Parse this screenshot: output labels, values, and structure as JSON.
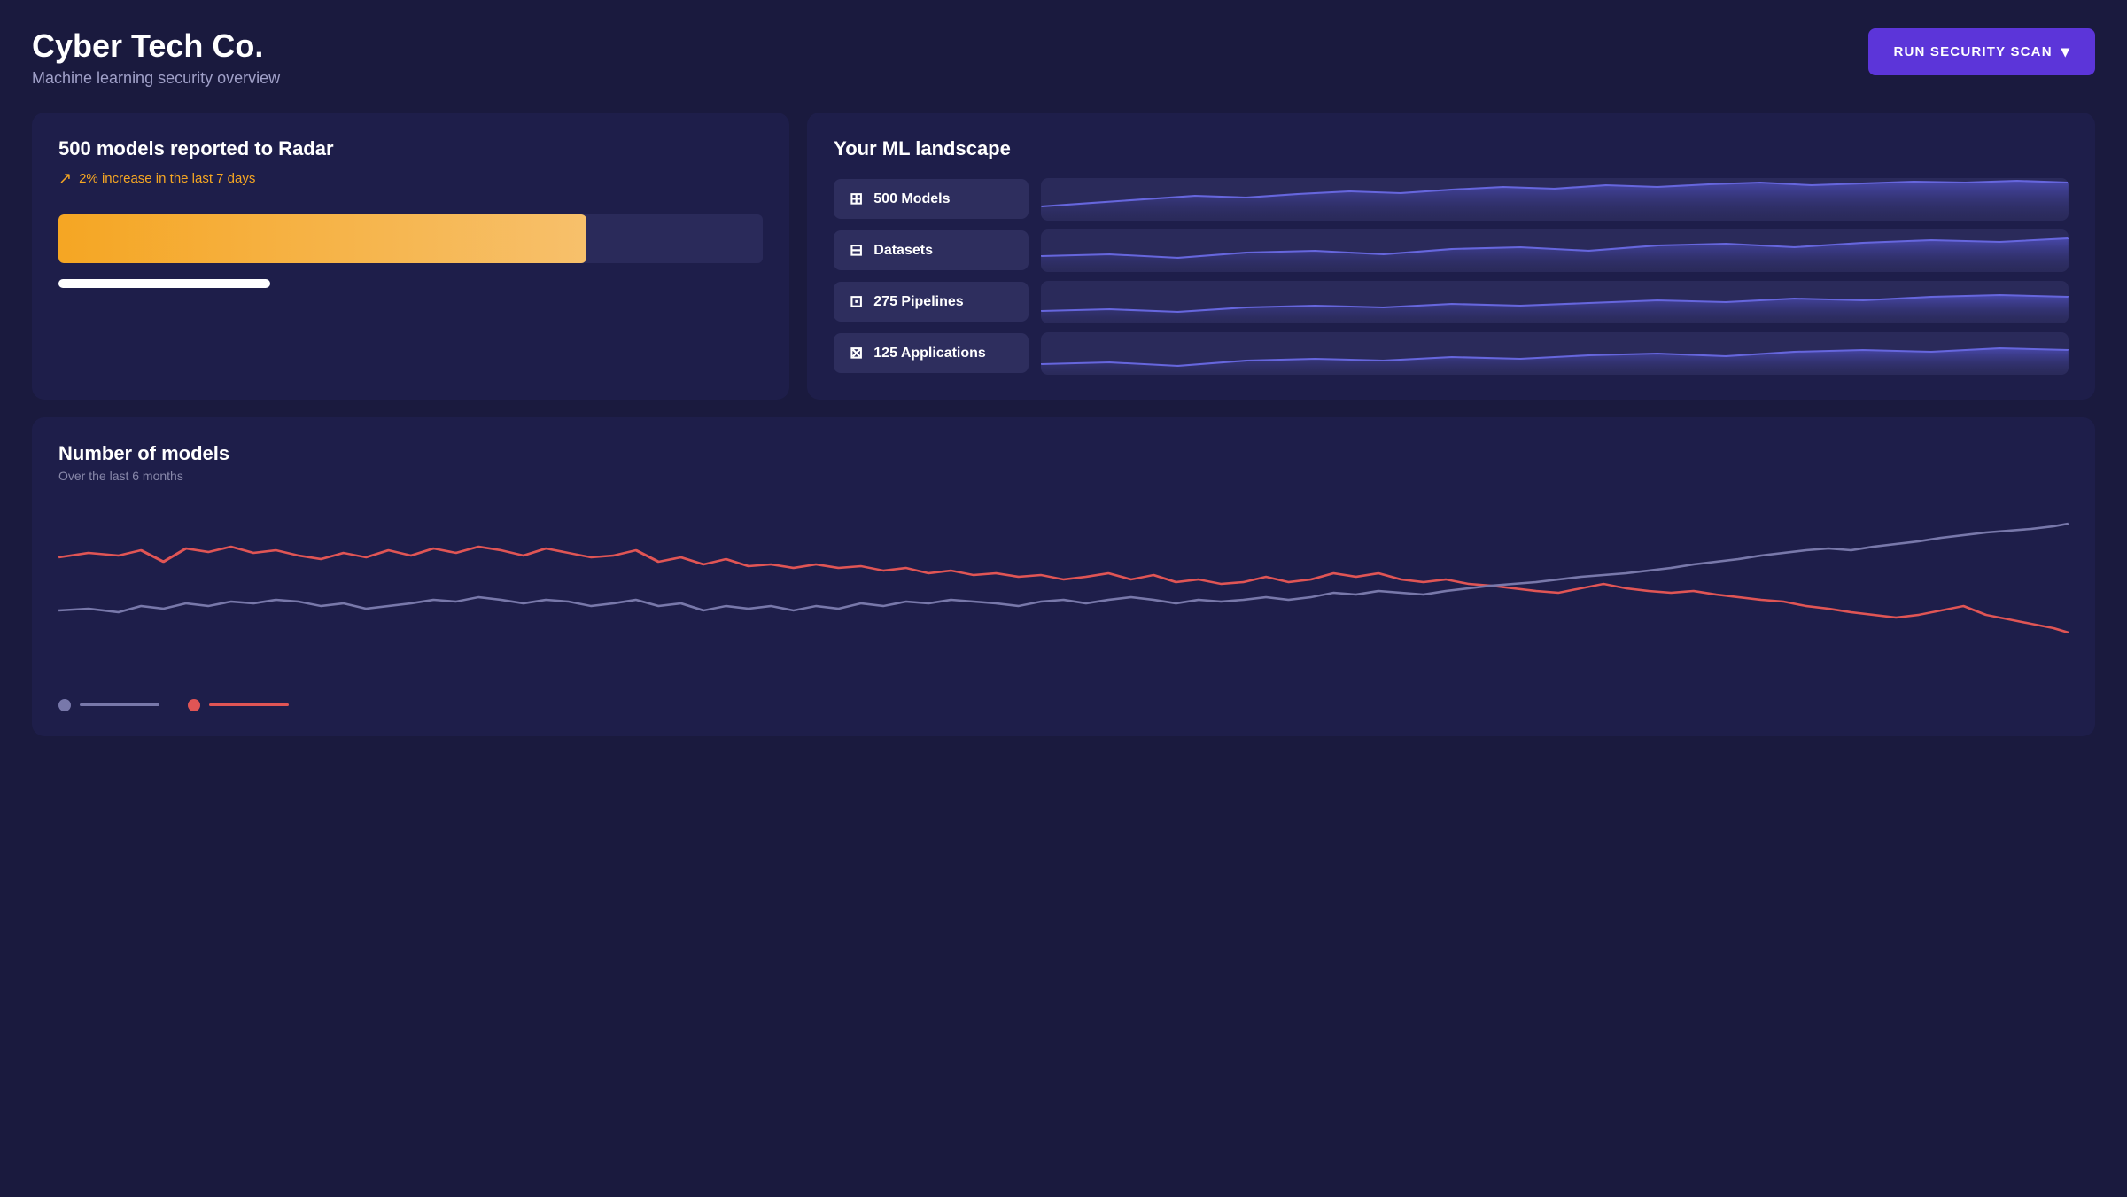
{
  "header": {
    "title": "Cyber Tech Co.",
    "subtitle": "Machine learning security overview",
    "run_scan_label": "RUN SECURITY SCAN"
  },
  "left_card": {
    "title": "500 models reported to Radar",
    "increase_text": "2% increase in the last 7 days",
    "progress_main_pct": 75,
    "progress_small_pct": 30
  },
  "right_card": {
    "title": "Your ML landscape",
    "items": [
      {
        "label": "500 Models",
        "icon": "⊞"
      },
      {
        "label": "Datasets",
        "icon": "⊟"
      },
      {
        "label": "275 Pipelines",
        "icon": "⊡"
      },
      {
        "label": "125 Applications",
        "icon": "⊠"
      }
    ]
  },
  "chart": {
    "title": "Number of models",
    "subtitle": "Over the last 6 months",
    "legend": [
      {
        "color": "#7878aa",
        "line_color": "#7878aa"
      },
      {
        "color": "#e05555",
        "line_color": "#e05555"
      }
    ]
  },
  "colors": {
    "accent_purple": "#5c35d9",
    "accent_orange": "#f5a623",
    "bg_dark": "#1a1a3e",
    "card_bg": "#1e1e4a",
    "sparkline_fill": "#4040a0",
    "sparkline_stroke": "#6060d0"
  }
}
